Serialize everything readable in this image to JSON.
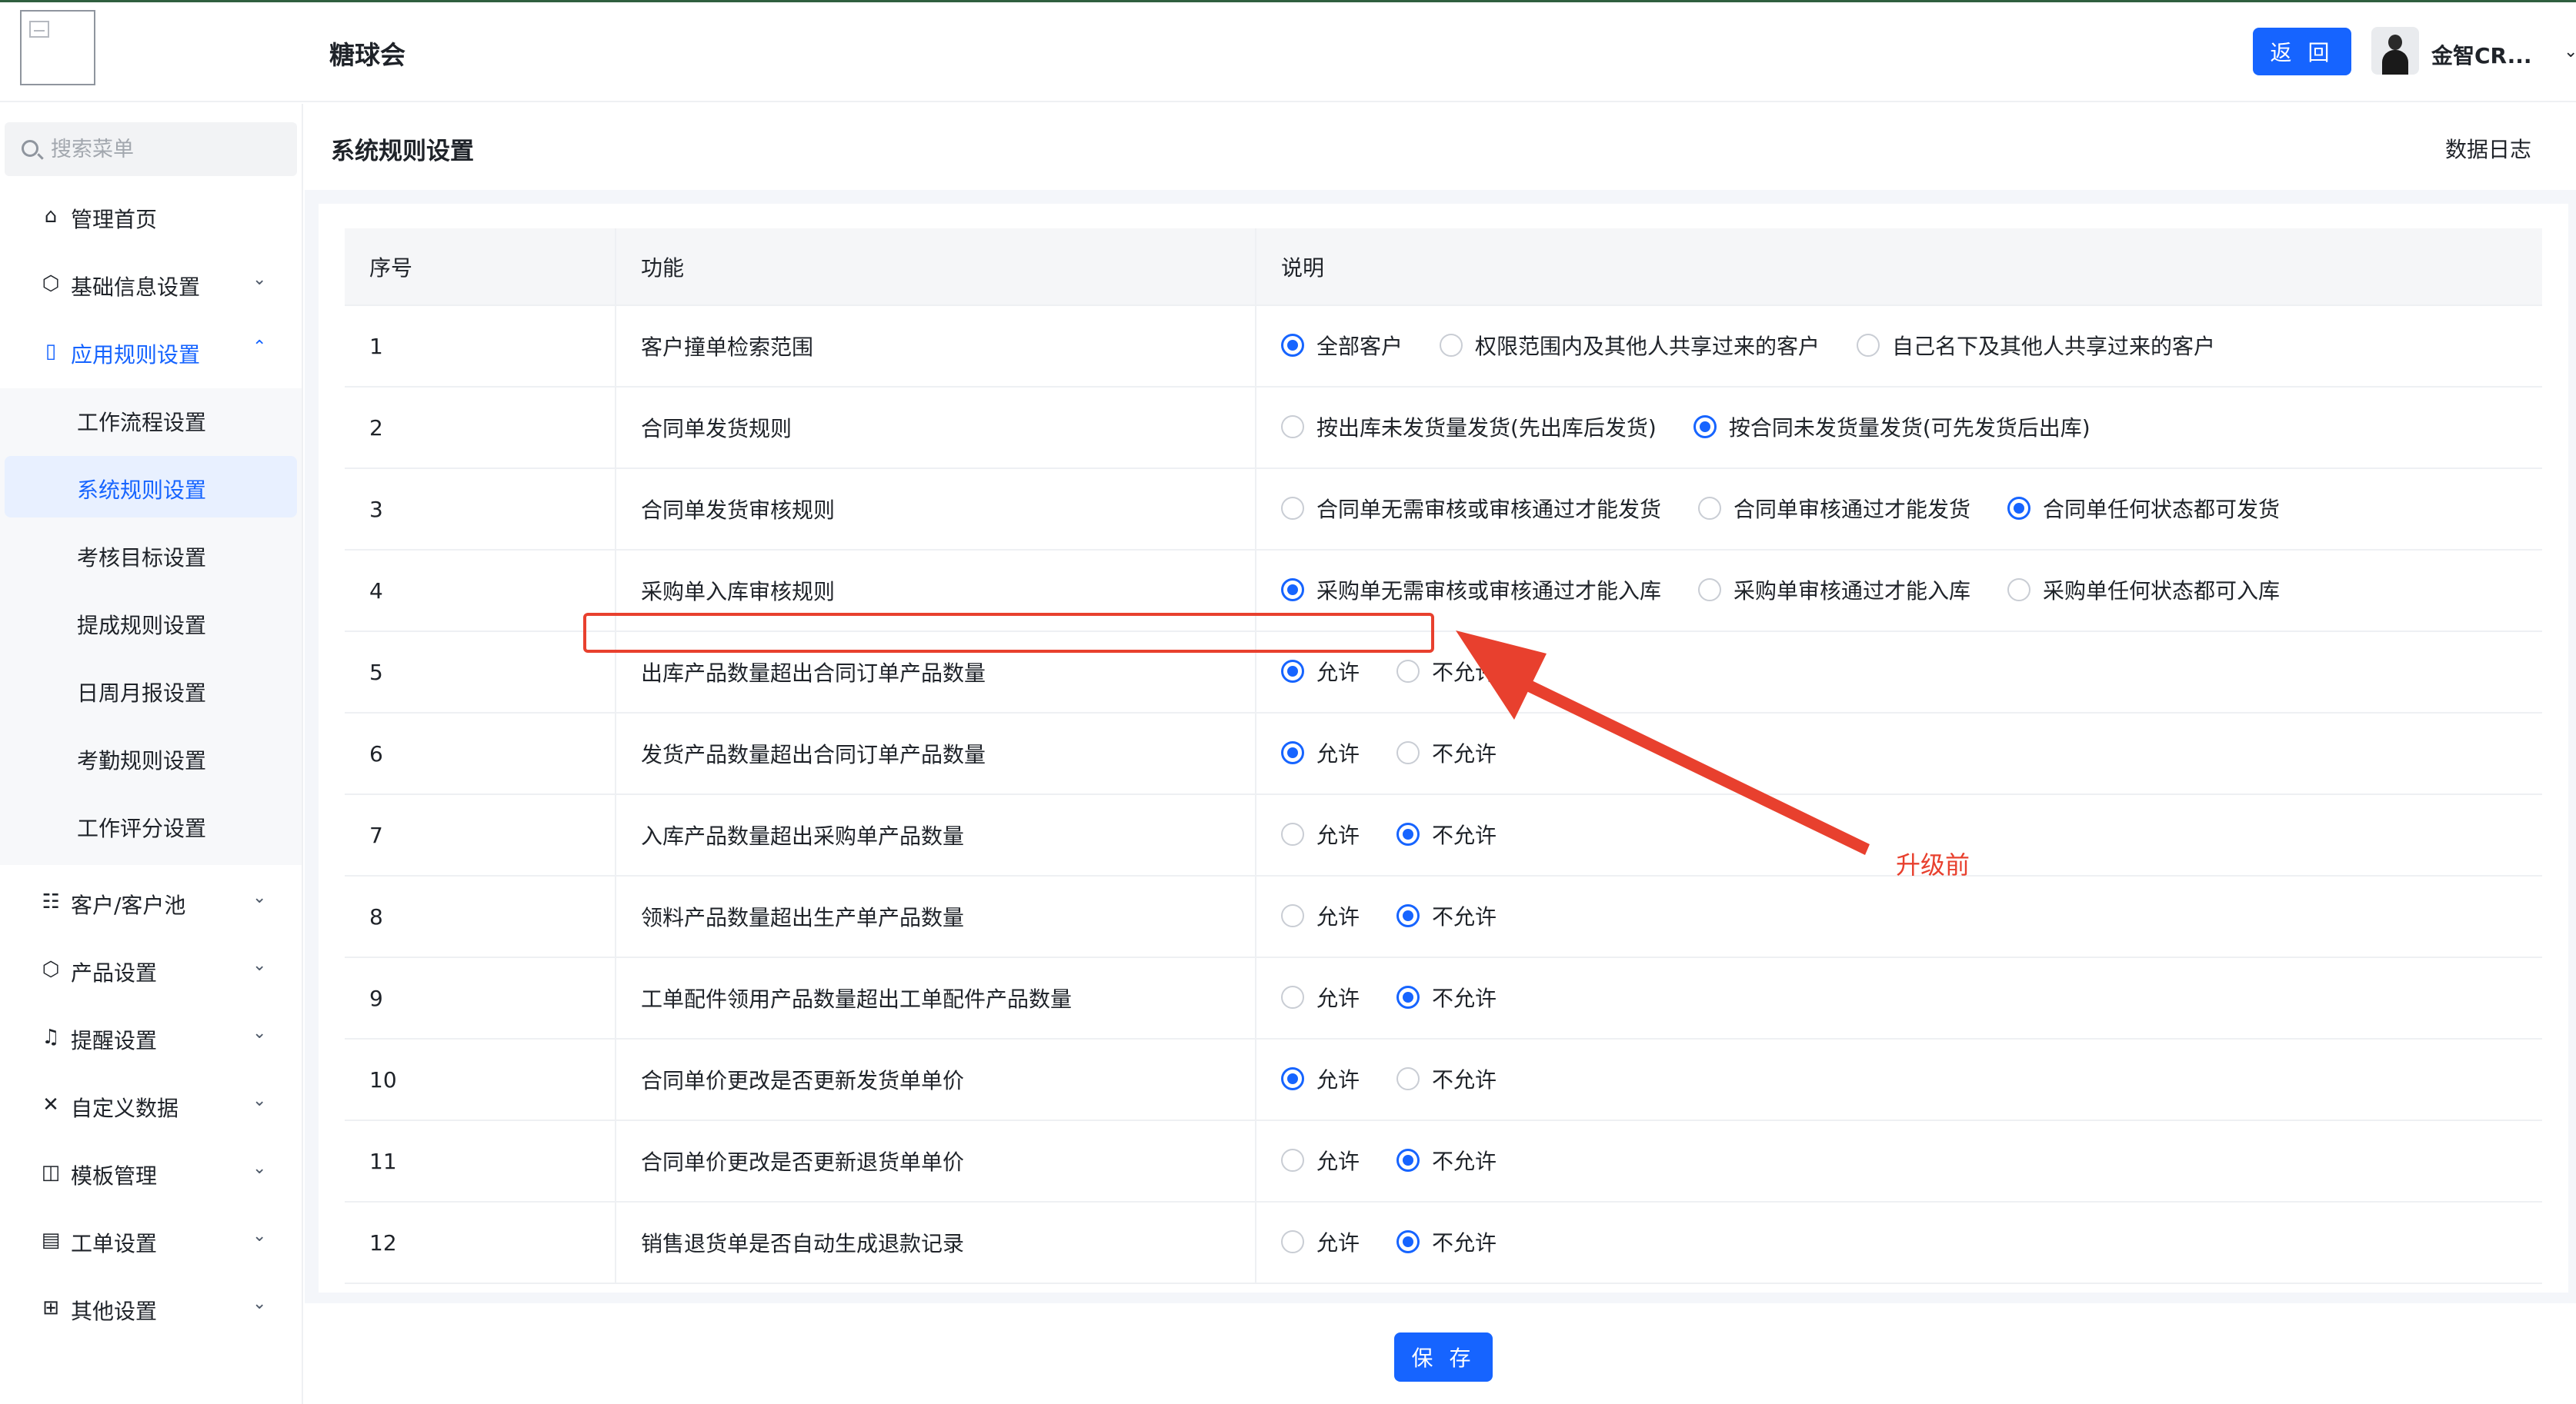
{
  "header": {
    "app_title": "糖球会",
    "back_label": "返 回",
    "user_name": "金智CR..."
  },
  "sidebar": {
    "search_placeholder": "搜索菜单",
    "items": [
      {
        "label": "管理首页",
        "icon": "home-icon"
      },
      {
        "label": "基础信息设置",
        "icon": "cube-icon"
      },
      {
        "label": "应用规则设置",
        "icon": "document-icon",
        "expanded": true
      },
      {
        "label": "客户/客户池",
        "icon": "contacts-icon"
      },
      {
        "label": "产品设置",
        "icon": "cube-icon"
      },
      {
        "label": "提醒设置",
        "icon": "bell-icon"
      },
      {
        "label": "自定义数据",
        "icon": "tools-icon"
      },
      {
        "label": "模板管理",
        "icon": "template-icon"
      },
      {
        "label": "工单设置",
        "icon": "ticket-icon"
      },
      {
        "label": "其他设置",
        "icon": "grid-icon"
      }
    ],
    "submenu": [
      {
        "label": "工作流程设置"
      },
      {
        "label": "系统规则设置",
        "selected": true
      },
      {
        "label": "考核目标设置"
      },
      {
        "label": "提成规则设置"
      },
      {
        "label": "日周月报设置"
      },
      {
        "label": "考勤规则设置"
      },
      {
        "label": "工作评分设置"
      }
    ]
  },
  "page": {
    "title": "系统规则设置",
    "data_log": "数据日志",
    "save_label": "保 存"
  },
  "table": {
    "headers": [
      "序号",
      "功能",
      "说明"
    ],
    "rows": [
      {
        "no": "1",
        "func": "客户撞单检索范围",
        "options": [
          "全部客户",
          "权限范围内及其他人共享过来的客户",
          "自己名下及其他人共享过来的客户"
        ],
        "selected": 0
      },
      {
        "no": "2",
        "func": "合同单发货规则",
        "options": [
          "按出库未发货量发货(先出库后发货)",
          "按合同未发货量发货(可先发货后出库)"
        ],
        "selected": 1
      },
      {
        "no": "3",
        "func": "合同单发货审核规则",
        "options": [
          "合同单无需审核或审核通过才能发货",
          "合同单审核通过才能发货",
          "合同单任何状态都可发货"
        ],
        "selected": 2
      },
      {
        "no": "4",
        "func": "采购单入库审核规则",
        "options": [
          "采购单无需审核或审核通过才能入库",
          "采购单审核通过才能入库",
          "采购单任何状态都可入库"
        ],
        "selected": 0
      },
      {
        "no": "5",
        "func": "出库产品数量超出合同订单产品数量",
        "options": [
          "允许",
          "不允许"
        ],
        "selected": 0
      },
      {
        "no": "6",
        "func": "发货产品数量超出合同订单产品数量",
        "options": [
          "允许",
          "不允许"
        ],
        "selected": 0
      },
      {
        "no": "7",
        "func": "入库产品数量超出采购单产品数量",
        "options": [
          "允许",
          "不允许"
        ],
        "selected": 1
      },
      {
        "no": "8",
        "func": "领料产品数量超出生产单产品数量",
        "options": [
          "允许",
          "不允许"
        ],
        "selected": 1
      },
      {
        "no": "9",
        "func": "工单配件领用产品数量超出工单配件产品数量",
        "options": [
          "允许",
          "不允许"
        ],
        "selected": 1
      },
      {
        "no": "10",
        "func": "合同单价更改是否更新发货单单价",
        "options": [
          "允许",
          "不允许"
        ],
        "selected": 0
      },
      {
        "no": "11",
        "func": "合同单价更改是否更新退货单单价",
        "options": [
          "允许",
          "不允许"
        ],
        "selected": 1
      },
      {
        "no": "12",
        "func": "销售退货单是否自动生成退款记录",
        "options": [
          "允许",
          "不允许"
        ],
        "selected": 1
      }
    ]
  },
  "annotation": {
    "label": "升级前",
    "color": "#e8402e"
  },
  "colors": {
    "primary": "#1664ff",
    "selected_bg": "#e8f0ff"
  }
}
